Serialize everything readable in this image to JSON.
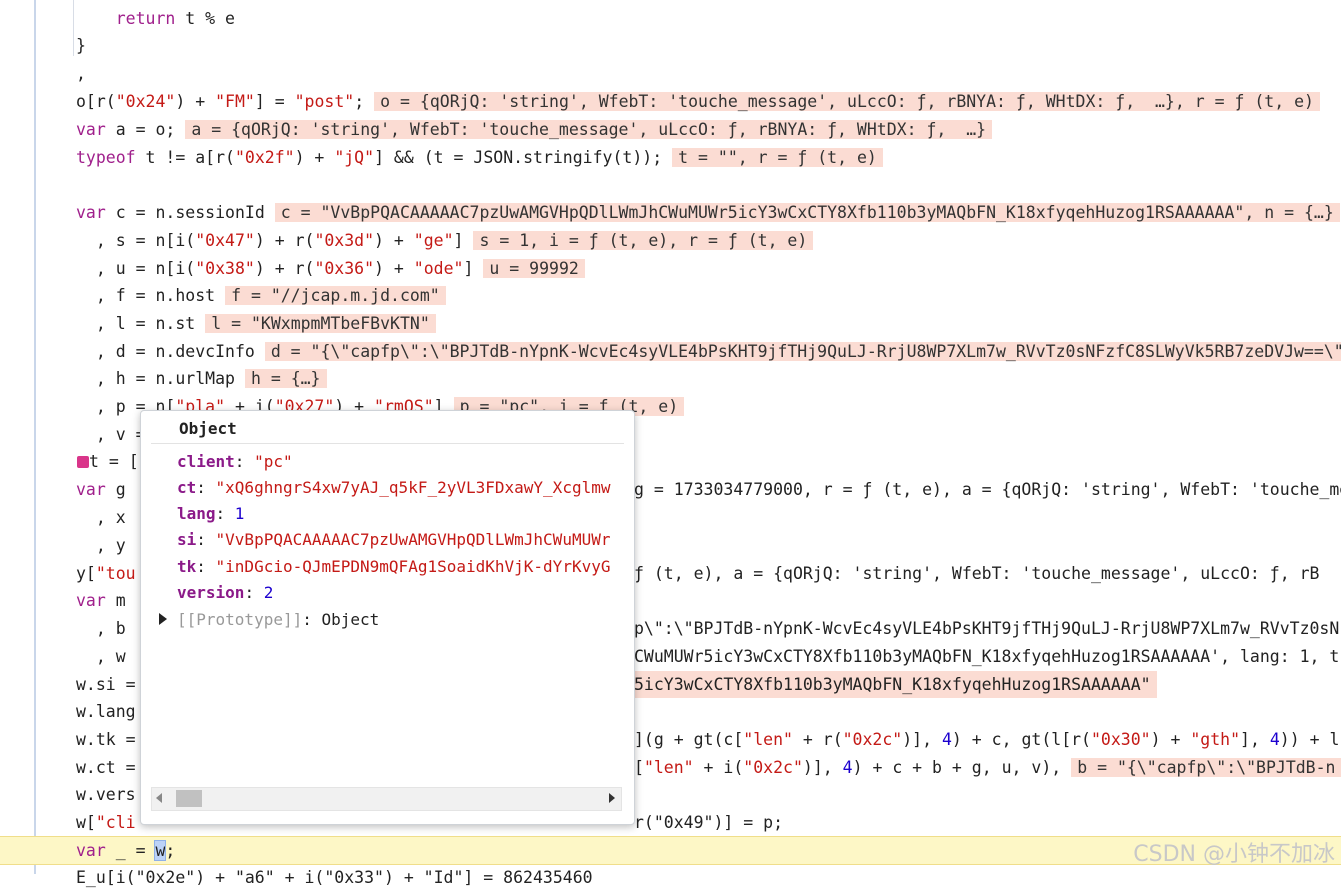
{
  "code": {
    "l1": "    return t % e",
    "l2": "}",
    "l3": ",",
    "l4_code_a": "o[r(",
    "l4_s1": "\"0x24\"",
    "l4_code_b": ") + ",
    "l4_s2": "\"FM\"",
    "l4_code_c": "] = ",
    "l4_s3": "\"post\"",
    "l4_code_d": ";",
    "l4_inline": "o = {qORjQ: 'string', WfebT: 'touche_message', uLccO: ƒ, rBNYA: ƒ, WHtDX: ƒ,  …}, r = ƒ (t, e)",
    "l5_kw": "var",
    "l5_code": " a = o;",
    "l5_inline": "a = {qORjQ: 'string', WfebT: 'touche_message', uLccO: ƒ, rBNYA: ƒ, WHtDX: ƒ,  …}",
    "l6_kw": "typeof",
    "l6_code_a": " t != a[r(",
    "l6_s1": "\"0x2f\"",
    "l6_code_b": ") + ",
    "l6_s2": "\"jQ\"",
    "l6_code_c": "] && (t = JSON.stringify(t));",
    "l6_inline": "t = \"\", r = ƒ (t, e)",
    "l8_kw": "var",
    "l8_code": " c = n.sessionId",
    "l8_inline": "c = \"VvBpPQACAAAAAC7pzUwAMGVHpQDlLWmJhCWuMUWr5icY3wCxCTY8Xfb110b3yMAQbFN_K18xfyqehHuzog1RSAAAAAA\", n = {…}",
    "l9_code_a": "  , s = n[i(",
    "l9_s1": "\"0x47\"",
    "l9_code_b": ") + r(",
    "l9_s2": "\"0x3d\"",
    "l9_code_c": ") + ",
    "l9_s3": "\"ge\"",
    "l9_code_d": "]",
    "l9_inline": "s = 1, i = ƒ (t, e), r = ƒ (t, e)",
    "l10_code_a": "  , u = n[i(",
    "l10_s1": "\"0x38\"",
    "l10_code_b": ") + r(",
    "l10_s2": "\"0x36\"",
    "l10_code_c": ") + ",
    "l10_s3": "\"ode\"",
    "l10_code_d": "]",
    "l10_inline": "u = 99992",
    "l11_code": "  , f = n.host",
    "l11_inline": "f = \"//jcap.m.jd.com\"",
    "l12_code": "  , l = n.st",
    "l12_inline": "l = \"KWxmpmMTbeFBvKTN\"",
    "l13_code": "  , d = n.devcInfo",
    "l13_inline": "d = \"{\\\"capfp\\\":\\\"BPJTdB-nYpnK-WcvEc4syVLE4bPsKHT9jfTHj9QuLJ-RrjU8WP7XLm7w_RVvTz0sNFzfC8SLWyVk5RB7zeDVJw==\\\"",
    "l14_code": "  , h = n.urlMap",
    "l14_inline": "h = {…}",
    "l15_code_a": "  , p = n[",
    "l15_s1": "\"pla\"",
    "l15_code_b": " + i(",
    "l15_s2": "\"0x27\"",
    "l15_code_c": ") + ",
    "l15_s3": "\"rmOS\"",
    "l15_code_d": "]",
    "l15_inline": "p = \"pc\", i = ƒ (t, e)",
    "l16_code": "  , v =",
    "l17_code": "t = [",
    "l18_kw": "var",
    "l18_code": " g",
    "l18_tail": "g = 1733034779000, r = ƒ (t, e), a = {qORjQ: 'string', WfebT: 'touche_me",
    "l19_code": "  , x",
    "l20_code": "  , y",
    "l21_code_a": "y[",
    "l21_s1": "\"tou",
    "l21_tail": "ƒ (t, e), a = {qORjQ: 'string', WfebT: 'touche_message', uLccO: ƒ, rB",
    "l22_kw": "var",
    "l22_code": " m",
    "l23_code": "  , b",
    "l23_tail": "p\\\":\\\"BPJTdB-nYpnK-WcvEc4syVLE4bPsKHT9jfTHj9QuLJ-RrjU8WP7XLm7w_RVvTz0sN",
    "l24_code": "  , w",
    "l24_tail": "CWuMUWr5icY3wCxCTY8Xfb110b3yMAQbFN_K18xfyqehHuzog1RSAAAAAA', lang: 1, t",
    "l25_code": "w.si =",
    "l25_tail": "5icY3wCxCTY8Xfb110b3yMAQbFN_K18xfyqehHuzog1RSAAAAAA\"",
    "l26_code": "w.lang",
    "l27_code": "w.tk =",
    "l27_tail_a": "](g + gt(c[",
    "l27_s1": "\"len\"",
    "l27_tail_b": " + r(",
    "l27_s2": "\"0x2c\"",
    "l27_tail_c": ")], ",
    "l27_n1": "4",
    "l27_tail_d": ") + c, gt(l[r(",
    "l27_s3": "\"0x30\"",
    "l27_tail_e": ") + ",
    "l27_s4": "\"gth\"",
    "l27_tail_f": "], ",
    "l27_n2": "4",
    "l27_tail_g": ")) + l,",
    "l28_code": "w.ct =",
    "l28_tail_a": "[",
    "l28_s1": "\"len\"",
    "l28_tail_b": " + i(",
    "l28_s2": "\"0x2c\"",
    "l28_tail_c": ")], ",
    "l28_n1": "4",
    "l28_tail_d": ") + c + b + g, u, v),",
    "l28_inline": "b = \"{\\\"capfp\\\":\\\"BPJTdB-n",
    "l29_code": "w.vers",
    "l30_code_a": "w[",
    "l30_s1": "\"cli",
    "l30_tail": "r(\"0x49\")] = p;",
    "l30_inline": "r = ƒ (t, e), p = \"pc\"",
    "l31_kw": "var",
    "l31_code_a": " _ = ",
    "l31_sel": "w",
    "l31_code_b": ";",
    "l32_code": "E_u[i(\"0x2e\") + \"a6\" + i(\"0x33\") + \"Id\"] = 862435460"
  },
  "popover": {
    "title": "Object",
    "props": [
      {
        "key": "client",
        "value": "\"pc\"",
        "type": "string"
      },
      {
        "key": "ct",
        "value": "\"xQ6ghngrS4xw7yAJ_q5kF_2yVL3FDxawY_Xcglmw",
        "type": "string"
      },
      {
        "key": "lang",
        "value": "1",
        "type": "number"
      },
      {
        "key": "si",
        "value": "\"VvBpPQACAAAAAC7pzUwAMGVHpQDlLWmJhCWuMUWr",
        "type": "string"
      },
      {
        "key": "tk",
        "value": "\"inDGcio-QJmEPDN9mQFAg1SoaidKhVjK-dYrKvyG",
        "type": "string"
      },
      {
        "key": "version",
        "value": "2",
        "type": "number"
      }
    ],
    "prototype_label": "[[Prototype]]",
    "prototype_value": ": Object"
  },
  "watermark": "CSDN @小钟不加冰"
}
